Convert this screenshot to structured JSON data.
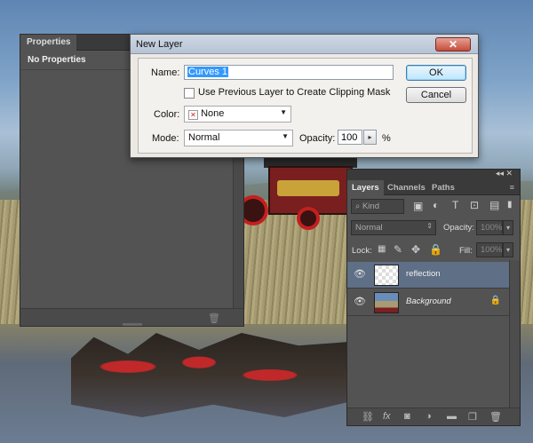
{
  "properties_panel": {
    "tab_label": "Properties",
    "content_label": "No Properties"
  },
  "dialog": {
    "title": "New Layer",
    "close_symbol": "✕",
    "name_label": "Name:",
    "name_value": "Curves 1",
    "clipping_label": "Use Previous Layer to Create Clipping Mask",
    "color_label": "Color:",
    "color_value": "None",
    "color_swatch": "✕",
    "mode_label": "Mode:",
    "mode_value": "Normal",
    "opacity_label": "Opacity:",
    "opacity_value": "100",
    "opacity_unit": "%",
    "ok_label": "OK",
    "cancel_label": "Cancel"
  },
  "layers_panel": {
    "collapse_icons": "◂◂  ✕",
    "tabs": [
      {
        "label": "Layers"
      },
      {
        "label": "Channels"
      },
      {
        "label": "Paths"
      }
    ],
    "filter_label": "Kind",
    "blend_mode": "Normal",
    "opacity_label": "Opacity:",
    "opacity_value": "100%",
    "lock_label": "Lock:",
    "fill_label": "Fill:",
    "fill_value": "100%",
    "layers": [
      {
        "name": "reflection",
        "selected": true
      },
      {
        "name": "Background",
        "selected": false
      }
    ]
  },
  "colors": {
    "panel_bg": "#535353",
    "selected_layer": "#5e6f86",
    "dialog_bg": "#ece9e4",
    "close_button": "#c74c3a"
  }
}
